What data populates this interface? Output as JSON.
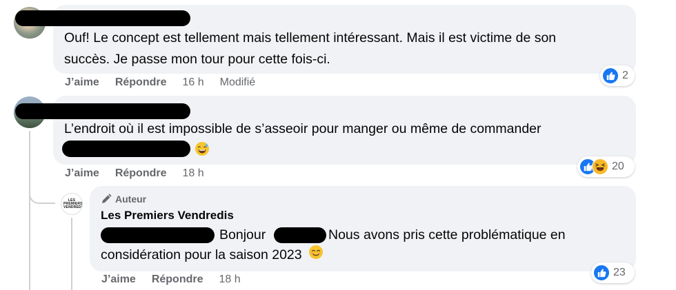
{
  "comments": [
    {
      "text_line1": "Ouf! Le concept est tellement mais tellement intéressant. Mais il est victime de son",
      "text_line2": "succès. Je passe mon tour pour cette fois-ci.",
      "like_label": "J’aime",
      "reply_label": "Répondre",
      "time": "16 h",
      "edited_label": "Modifié",
      "reaction_count": "2",
      "reaction_icons": [
        "like-icon"
      ]
    },
    {
      "text_line1": "L’endroit où il est impossible de s’asseoir pour manger ou même de commander",
      "like_label": "J’aime",
      "reply_label": "Répondre",
      "time": "18 h",
      "reaction_count": "20",
      "reaction_icons": [
        "like-icon",
        "haha-icon"
      ]
    }
  ],
  "reply": {
    "badge_label": "Auteur",
    "author_name": "Les Premiers Vendredis",
    "logo_text": "LES PREMIERS VENDREDIS",
    "text_part1": "Bonjour",
    "text_part2": "Nous avons pris cette problématique en",
    "text_line2": "considération pour la saison 2023",
    "like_label": "J’aime",
    "reply_label": "Répondre",
    "time": "18 h",
    "reaction_count": "23",
    "reaction_icons": [
      "like-icon"
    ]
  },
  "colors": {
    "like_blue": "#1877f2",
    "bubble_bg": "#f0f2f5",
    "meta_gray": "#65676b",
    "haha_yellow": "#f7b928"
  }
}
